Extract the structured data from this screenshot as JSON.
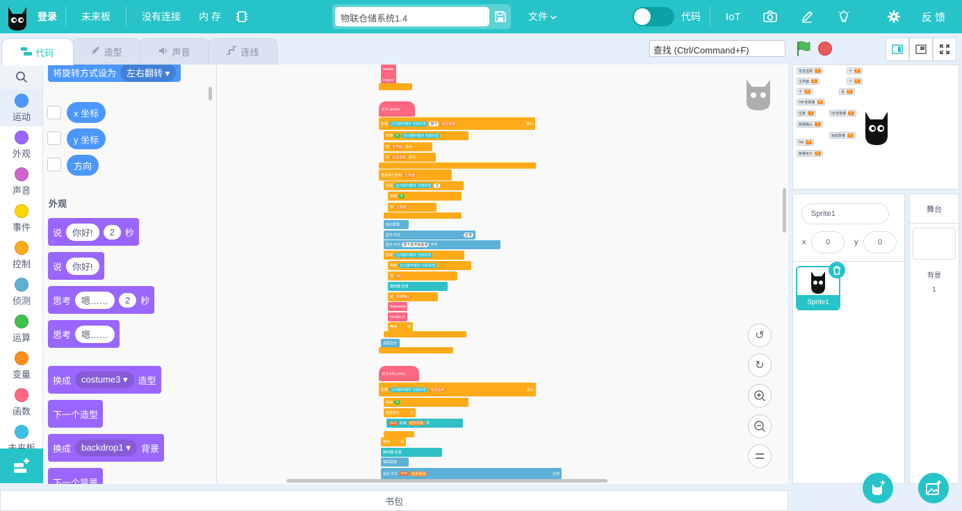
{
  "topbar": {
    "login": "登录",
    "board": "未来板",
    "connection": "没有连接",
    "memory": "内 存",
    "project_name": "物联仓储系统1.4",
    "file_menu": "文件",
    "code_toggle_label": "代码",
    "iot": "IoT",
    "feedback": "反 馈"
  },
  "tabs": {
    "code": "代码",
    "costume": "造型",
    "sound": "声音",
    "wiring": "连线"
  },
  "find": {
    "placeholder": "查找 (Ctrl/Command+F)"
  },
  "categories": [
    {
      "label": "运动",
      "color": "#4c97ff"
    },
    {
      "label": "外观",
      "color": "#9966ff"
    },
    {
      "label": "声音",
      "color": "#cf63cf"
    },
    {
      "label": "事件",
      "color": "#ffd500"
    },
    {
      "label": "控制",
      "color": "#ffab19"
    },
    {
      "label": "侦测",
      "color": "#5cb1d6"
    },
    {
      "label": "运算",
      "color": "#40bf4a"
    },
    {
      "label": "变量",
      "color": "#ff8c1a"
    },
    {
      "label": "函数",
      "color": "#ff6680"
    },
    {
      "label": "未来板",
      "color": "#3fbfe3"
    }
  ],
  "palette": {
    "rotation_block": "将旋转方式设为",
    "rotation_value": "左右翻转",
    "x_position": "x 坐标",
    "y_position": "y 坐标",
    "direction": "方向",
    "looks_title": "外观",
    "say_for": {
      "say": "说",
      "text": "你好!",
      "secs": "2",
      "unit": "秒"
    },
    "say": {
      "say": "说",
      "text": "你好!"
    },
    "think_for": {
      "think": "思考",
      "text": "嗯……",
      "secs": "2",
      "unit": "秒"
    },
    "think": {
      "think": "思考",
      "text": "嗯……"
    },
    "switch_costume": {
      "prefix": "换成",
      "value": "costume3",
      "suffix": "造型"
    },
    "next_costume": "下一个造型",
    "switch_backdrop": {
      "prefix": "换成",
      "value": "backdrop1",
      "suffix": "背景"
    },
    "next_backdrop": "下一个背景"
  },
  "backpack": "书包",
  "scripts": {
    "top": {
      "row1": "update",
      "row2": "Inquire"
    },
    "update_def": "定义  update",
    "entry_def": "定义  EOI_entry",
    "labels": {
      "repeat_until": "重复执行直到",
      "if": "如果",
      "then": "那么",
      "wait_until": "等待",
      "not": "不",
      "set": "将",
      "to": "设为",
      "fill": "填充屏幕",
      "show_text": "显示 中文",
      "wait": "等待",
      "secs": "秒",
      "nav_key": "五向摇杆模块 当前状态",
      "down": "按下",
      "left": "左",
      "main_menu": "主界面",
      "info_select": "信息选择",
      "repeat_exit": "重复执行",
      "times": "次",
      "buzzer": "蜂鸣器 音调",
      "beat": "节拍",
      "tag": "tag",
      "data_confirm": "数据确认",
      "reposition": "Reposition",
      "include": "Include H",
      "clear": "清屏显示",
      "data": "data",
      "item": "的第",
      "item_of": "项",
      "yes": "是",
      "normal": "正常",
      "size": "字号",
      "press_start": "按下此开始监测"
    }
  },
  "stage_monitors": [
    {
      "label": "信息选择",
      "value": "1"
    },
    {
      "label": "主界面",
      "value": "1"
    },
    {
      "label": "千",
      "value": "0"
    },
    {
      "label": "H形变数量",
      "value": "0"
    },
    {
      "label": "位数",
      "value": "3"
    },
    {
      "label": "数据确认",
      "value": "1"
    },
    {
      "label": "tag",
      "value": "0"
    },
    {
      "label": "数量统计",
      "value": "0"
    },
    {
      "label": "十",
      "value": "0"
    },
    {
      "label": "个",
      "value": "0"
    },
    {
      "label": "百",
      "value": "0"
    },
    {
      "label": "I形变数量",
      "value": "0"
    },
    {
      "label": "锁变数量",
      "value": "0"
    }
  ],
  "sprite": {
    "name": "Sprite1",
    "x_label": "x",
    "y_label": "y",
    "x": "0",
    "y": "0",
    "thumb_label": "Sprite1"
  },
  "stage_pane": {
    "title": "舞台",
    "backdrop_label": "背景",
    "backdrop_count": "1"
  }
}
